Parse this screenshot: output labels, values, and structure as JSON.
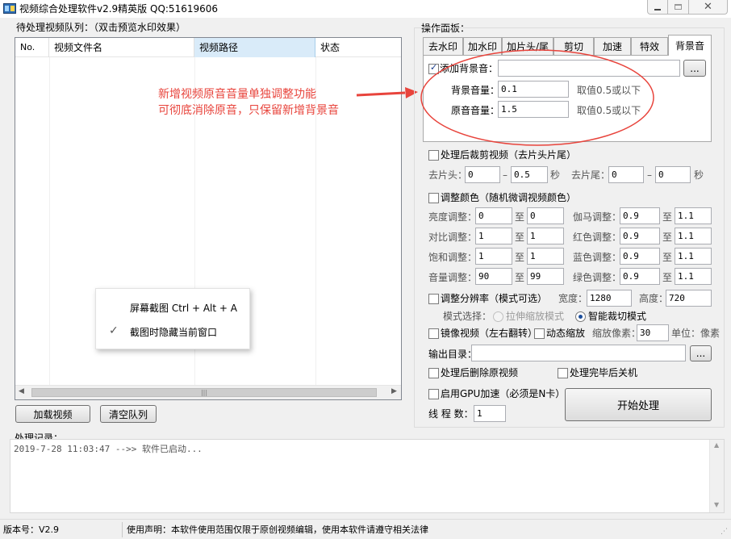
{
  "window": {
    "title": "视频综合处理软件v2.9精英版  QQ:51619606"
  },
  "queue": {
    "label": "待处理视频队列：（双击预览水印效果）",
    "headers": [
      "No.",
      "视频文件名",
      "视频路径",
      "状态"
    ],
    "load_button": "加载视频",
    "clear_button": "清空队列"
  },
  "context_menu": {
    "item1": "屏幕截图 Ctrl + Alt + A",
    "item2": "截图时隐藏当前窗口"
  },
  "annotation": {
    "line1": "新增视频原音音量单独调整功能",
    "line2": "可彻底消除原音，只保留新增背景音",
    "color": "#e8443c"
  },
  "panel": {
    "label": "操作面板：",
    "tabs": [
      "去水印",
      "加水印",
      "加片头/尾",
      "剪切",
      "加速",
      "特效",
      "背景音"
    ],
    "bgm": {
      "add_label": "添加背景音：",
      "path_value": "",
      "browse": "...",
      "bg_volume_label": "背景音量：",
      "bg_volume_value": "0.1",
      "orig_volume_label": "原音音量：",
      "orig_volume_value": "1.5",
      "hint": "取值0.5或以下"
    },
    "trim": {
      "check_label": "处理后裁剪视频（去片头片尾）",
      "head_label": "去片头：",
      "head_from": "0",
      "head_to": "0.5",
      "tail_label": "去片尾：",
      "tail_from": "0",
      "tail_to": "0",
      "dash": "–",
      "sec": "秒"
    },
    "color": {
      "check_label": "调整颜色（随机微调视频颜色）",
      "to": "至",
      "rows": [
        {
          "l_label": "亮度调整：",
          "l_from": "0",
          "l_to": "0",
          "r_label": "伽马调整：",
          "r_from": "0.9",
          "r_to": "1.1"
        },
        {
          "l_label": "对比调整：",
          "l_from": "1",
          "l_to": "1",
          "r_label": "红色调整：",
          "r_from": "0.9",
          "r_to": "1.1"
        },
        {
          "l_label": "饱和调整：",
          "l_from": "1",
          "l_to": "1",
          "r_label": "蓝色调整：",
          "r_from": "0.9",
          "r_to": "1.1"
        },
        {
          "l_label": "音量调整：",
          "l_from": "90",
          "l_to": "99",
          "r_label": "绿色调整：",
          "r_from": "0.9",
          "r_to": "1.1"
        }
      ]
    },
    "resolution": {
      "check_label": "调整分辨率（模式可选）",
      "width_label": "宽度：",
      "width_value": "1280",
      "height_label": "高度：",
      "height_value": "720",
      "mode_label": "模式选择：",
      "mode_stretch": "拉伸缩放模式",
      "mode_crop": "智能裁切模式"
    },
    "mirror": {
      "check_label": "镜像视频（左右翻转）",
      "zoom_label": "动态缩放",
      "pixels_label": "缩放像素：",
      "pixels_value": "30",
      "unit_label": "单位：像素"
    },
    "output": {
      "label": "输出目录：",
      "value": "",
      "browse": "..."
    },
    "delete_source": "处理后删除原视频",
    "shutdown": "处理完毕后关机",
    "gpu": "启用GPU加速（必须是N卡）",
    "threads_label": "线 程 数：",
    "threads_value": "1",
    "start_button": "开始处理"
  },
  "log": {
    "label": "处理记录：",
    "line": "2019-7-28 11:03:47 -->> 软件已启动..."
  },
  "status": {
    "version": "版本号：V2.9",
    "notice": "使用声明：本软件使用范围仅限于原创视频编辑，使用本软件请遵守相关法律"
  }
}
